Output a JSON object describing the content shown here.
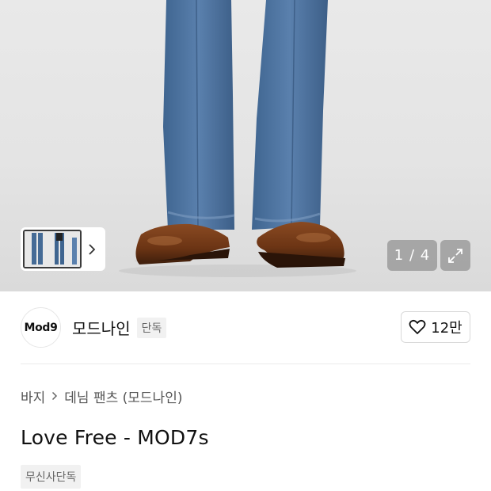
{
  "gallery": {
    "counter": "1 / 4",
    "icons": {
      "thumb_next": "chevron-right-icon",
      "expand": "expand-icon"
    }
  },
  "brand": {
    "logo_text": "Mod9",
    "name": "모드나인",
    "badge": "단독"
  },
  "like": {
    "count": "12만",
    "icon": "heart-icon"
  },
  "breadcrumb": {
    "items": [
      "바지",
      "데님 팬츠 (모드나인)"
    ]
  },
  "product": {
    "title": "Love Free - MOD7s",
    "tag": "무신사단독"
  },
  "colors": {
    "denim": "#4a6f9c",
    "boot": "#7a3f1c",
    "background": "#e6e6e6"
  }
}
